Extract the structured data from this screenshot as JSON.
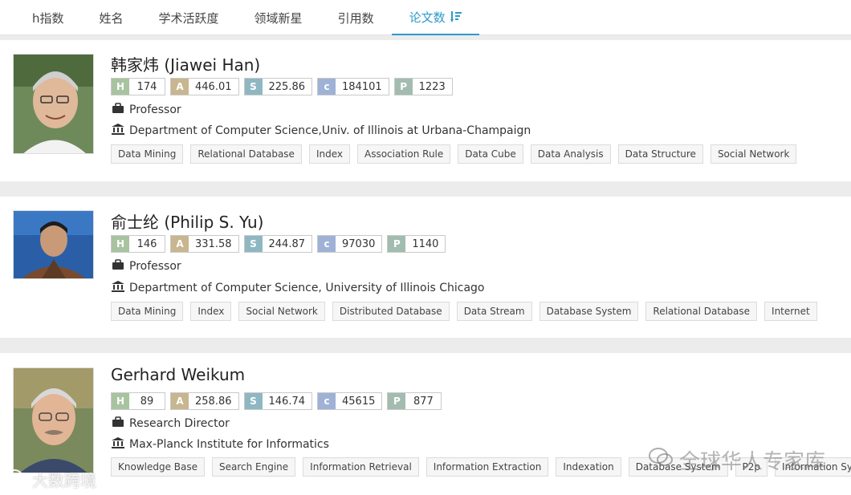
{
  "tabs": [
    {
      "label": "h指数"
    },
    {
      "label": "姓名"
    },
    {
      "label": "学术活跃度"
    },
    {
      "label": "领域新星"
    },
    {
      "label": "引用数"
    },
    {
      "label": "论文数"
    }
  ],
  "active_tab": "论文数",
  "colors": {
    "accent": "#2d9bc7",
    "metric_H": "#a8c3a0",
    "metric_A": "#c7b68f",
    "metric_S": "#8fb7c2",
    "metric_c": "#9fb2d6",
    "metric_P": "#a2bdb0"
  },
  "people": [
    {
      "name": "韩家炜 (Jiawei Han)",
      "metrics": {
        "H": "174",
        "A": "446.01",
        "S": "225.86",
        "c": "184101",
        "P": "1223"
      },
      "position": "Professor",
      "affiliation": "Department of Computer Science,Univ. of Illinois at Urbana-Champaign",
      "tags": [
        "Data Mining",
        "Relational Database",
        "Index",
        "Association Rule",
        "Data Cube",
        "Data Analysis",
        "Data Structure",
        "Social Network"
      ]
    },
    {
      "name": "俞士纶 (Philip S. Yu)",
      "metrics": {
        "H": "146",
        "A": "331.58",
        "S": "244.87",
        "c": "97030",
        "P": "1140"
      },
      "position": "Professor",
      "affiliation": "Department of Computer Science, University of Illinois Chicago",
      "tags": [
        "Data Mining",
        "Index",
        "Social Network",
        "Distributed Database",
        "Data Stream",
        "Database System",
        "Relational Database",
        "Internet"
      ]
    },
    {
      "name": "Gerhard Weikum",
      "metrics": {
        "H": "89",
        "A": "258.86",
        "S": "146.74",
        "c": "45615",
        "P": "877"
      },
      "position": "Research Director",
      "affiliation": "Max-Planck Institute for Informatics",
      "tags": [
        "Knowledge Base",
        "Search Engine",
        "Information Retrieval",
        "Information Extraction",
        "Indexation",
        "Database System",
        "P2p",
        "Information System"
      ]
    }
  ],
  "metric_keys": [
    "H",
    "A",
    "S",
    "c",
    "P"
  ],
  "watermarks": {
    "right": "全球华人专家库",
    "left": "大数跨境"
  },
  "icons": {
    "position": "briefcase-icon",
    "affiliation": "institution-icon",
    "sort": "sort-descending-icon"
  }
}
